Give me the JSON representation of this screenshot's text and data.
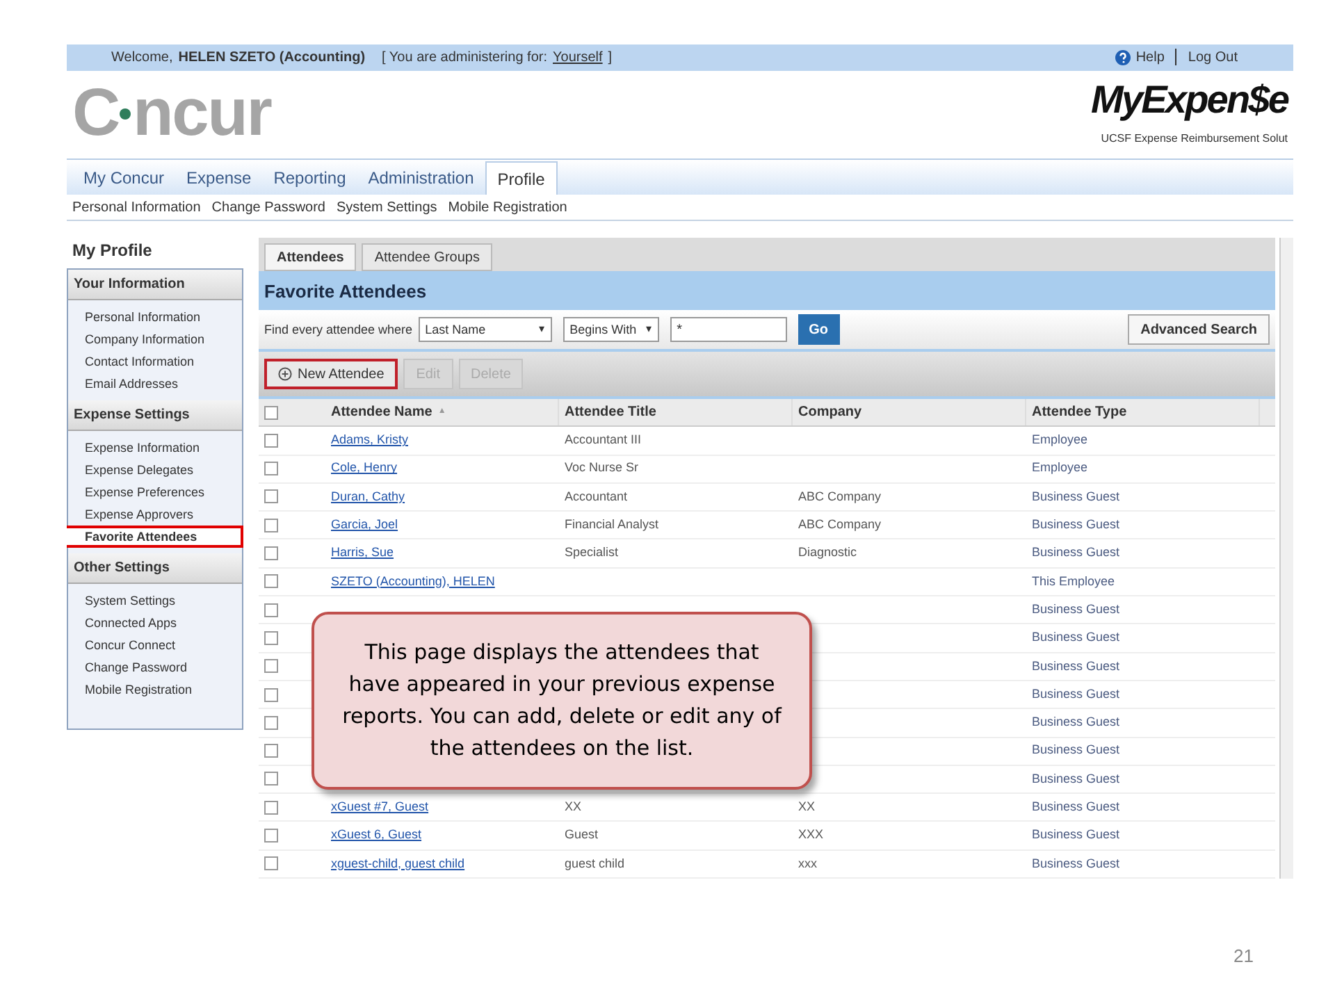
{
  "top_bar": {
    "welcome": "Welcome,",
    "user": "HELEN SZETO (Accounting)",
    "administering": "[ You are administering for:",
    "administering_link": "Yourself",
    "administering_end": "]",
    "help": "Help",
    "logout": "Log Out"
  },
  "logo": {
    "brand_left": "C",
    "brand_right": "ncur",
    "product": "MyExpen$e",
    "tagline": "UCSF Expense Reimbursement Solut"
  },
  "nav_tabs": [
    {
      "label": "My Concur",
      "selected": false
    },
    {
      "label": "Expense",
      "selected": false
    },
    {
      "label": "Reporting",
      "selected": false
    },
    {
      "label": "Administration",
      "selected": false
    },
    {
      "label": "Profile",
      "selected": true
    }
  ],
  "sub_nav": [
    "Personal Information",
    "Change Password",
    "System Settings",
    "Mobile Registration"
  ],
  "sidebar": {
    "title": "My Profile",
    "sections": [
      {
        "heading": "Your Information",
        "items": [
          {
            "label": "Personal Information",
            "selected": false
          },
          {
            "label": "Company Information",
            "selected": false
          },
          {
            "label": "Contact Information",
            "selected": false
          },
          {
            "label": "Email Addresses",
            "selected": false
          }
        ]
      },
      {
        "heading": "Expense Settings",
        "items": [
          {
            "label": "Expense Information",
            "selected": false
          },
          {
            "label": "Expense Delegates",
            "selected": false
          },
          {
            "label": "Expense Preferences",
            "selected": false
          },
          {
            "label": "Expense Approvers",
            "selected": false
          },
          {
            "label": "Favorite Attendees",
            "selected": true
          }
        ]
      },
      {
        "heading": "Other Settings",
        "items": [
          {
            "label": "System Settings",
            "selected": false
          },
          {
            "label": "Connected Apps",
            "selected": false
          },
          {
            "label": "Concur Connect",
            "selected": false
          },
          {
            "label": "Change Password",
            "selected": false
          },
          {
            "label": "Mobile Registration",
            "selected": false
          }
        ]
      }
    ]
  },
  "content_tabs": [
    {
      "label": "Attendees",
      "selected": true
    },
    {
      "label": "Attendee Groups",
      "selected": false
    }
  ],
  "panel_title": "Favorite Attendees",
  "search": {
    "label": "Find every attendee where",
    "caret": "▾",
    "field": "Last Name",
    "operator": "Begins With",
    "value": "*",
    "go": "Go",
    "advanced": "Advanced Search"
  },
  "toolbar": [
    {
      "label": "New Attendee",
      "disabled": false,
      "highlighted": true
    },
    {
      "label": "Edit",
      "disabled": true,
      "highlighted": false
    },
    {
      "label": "Delete",
      "disabled": true,
      "highlighted": false
    }
  ],
  "table": {
    "select_all_checked": false,
    "sort_indicator": "▲",
    "columns": [
      "Attendee Name",
      "Attendee Title",
      "Company",
      "Attendee Type"
    ],
    "rows": [
      {
        "checked": false,
        "name": "Adams, Kristy",
        "title": "Accountant III",
        "company": "",
        "type": "Employee"
      },
      {
        "checked": false,
        "name": "Cole, Henry",
        "title": "Voc Nurse Sr",
        "company": "",
        "type": "Employee"
      },
      {
        "checked": false,
        "name": "Duran, Cathy",
        "title": "Accountant",
        "company": "ABC Company",
        "type": "Business Guest"
      },
      {
        "checked": false,
        "name": "Garcia, Joel",
        "title": "Financial Analyst",
        "company": "ABC Company",
        "type": "Business Guest"
      },
      {
        "checked": false,
        "name": "Harris, Sue",
        "title": "Specialist",
        "company": "Diagnostic",
        "type": "Business Guest"
      },
      {
        "checked": false,
        "name": "SZETO (Accounting), HELEN",
        "title": "",
        "company": "",
        "type": "This Employee"
      },
      {
        "checked": false,
        "name": "",
        "title": "",
        "company": "",
        "type": "Business Guest"
      },
      {
        "checked": false,
        "name": "",
        "title": "",
        "company": "",
        "type": "Business Guest"
      },
      {
        "checked": false,
        "name": "",
        "title": "",
        "company": "",
        "type": "Business Guest"
      },
      {
        "checked": false,
        "name": "",
        "title": "",
        "company": "",
        "type": "Business Guest"
      },
      {
        "checked": false,
        "name": "",
        "title": "",
        "company": "",
        "type": "Business Guest"
      },
      {
        "checked": false,
        "name": "",
        "title": "",
        "company": "",
        "type": "Business Guest"
      },
      {
        "checked": false,
        "name": "",
        "title": "",
        "company": "",
        "type": "Business Guest"
      },
      {
        "checked": false,
        "name": "xGuest #7, Guest",
        "title": "XX",
        "company": "XX",
        "type": "Business Guest"
      },
      {
        "checked": false,
        "name": "xGuest 6, Guest",
        "title": "Guest",
        "company": "XXX",
        "type": "Business Guest"
      },
      {
        "checked": false,
        "name": "xguest-child, guest child",
        "title": "guest child",
        "company": "xxx",
        "type": "Business Guest"
      }
    ]
  },
  "callout": "This page displays the attendees that have appeared in your previous expense reports. You can add, delete or edit any of the attendees on the list.",
  "slide_number": "21"
}
